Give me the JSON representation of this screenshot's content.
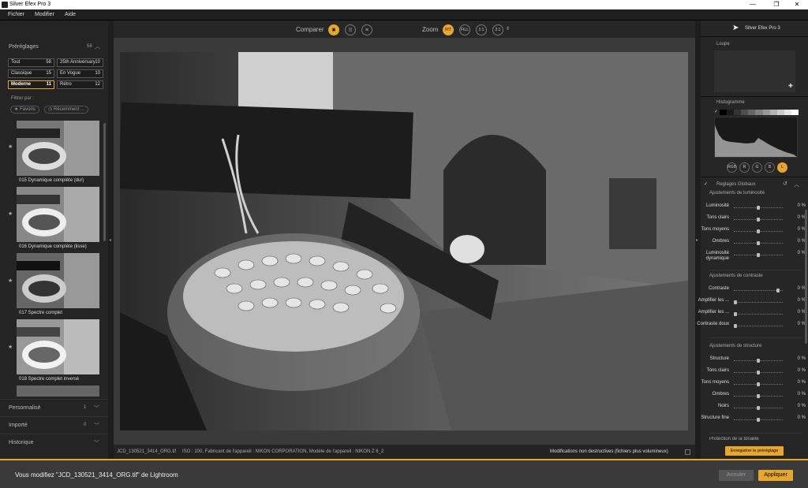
{
  "window": {
    "title": "Silver Efex Pro 3",
    "min": "—",
    "max": "❐",
    "close": "✕"
  },
  "menu": [
    "Fichier",
    "Modifier",
    "Aide"
  ],
  "left": {
    "presets_title": "Préréglages",
    "presets_count": "58",
    "presets": [
      {
        "label": "Tout",
        "count": "58"
      },
      {
        "label": "25th Anniversary",
        "count": "10"
      },
      {
        "label": "Classique",
        "count": "15"
      },
      {
        "label": "En Vogue",
        "count": "10"
      },
      {
        "label": "Moderne",
        "count": "11",
        "selected": true
      },
      {
        "label": "Rétro",
        "count": "12"
      }
    ],
    "filter_label": "Filtrer par :",
    "filter_favorites": "Favoris",
    "filter_recent": "Récemment ...",
    "items": [
      {
        "label": "015 Dynamique complète (dur)"
      },
      {
        "label": "016 Dynamique complète (lisse)"
      },
      {
        "label": "017 Spectre complet"
      },
      {
        "label": "018 Spectre complet inversé"
      }
    ],
    "custom": {
      "title": "Personnalisé",
      "count": "1"
    },
    "imported": {
      "title": "Importé",
      "count": "0"
    },
    "history": {
      "title": "Historique"
    }
  },
  "toolbar": {
    "compare_label": "Comparer",
    "zoom_label": "Zoom",
    "zoom_options": [
      "FIT",
      "FILL",
      "1:1",
      "2:1"
    ]
  },
  "status": {
    "filename": "JCD_130521_3414_ORG.tif",
    "meta": "ISO : 100, Fabricant de l'appareil : NIKON CORPORATION, Modèle de l'appareil : NIKON Z 6_2",
    "nondestructive": "Modifications non destructives (fichiers plus volumineux)"
  },
  "right": {
    "brand": "Silver Efex Pro 3",
    "loupe": "Loupe",
    "histogram": "Histogramme",
    "channels": [
      "RGB",
      "R",
      "G",
      "B",
      "L"
    ],
    "global_title": "Reglages Globaux",
    "lum_group": "Ajustements de luminosité",
    "lum": [
      {
        "label": "Luminosité",
        "value": "0 %",
        "pos": 0.5
      },
      {
        "label": "Tons clairs",
        "value": "0 %",
        "pos": 0.5
      },
      {
        "label": "Tons moyens",
        "value": "0 %",
        "pos": 0.5
      },
      {
        "label": "Ombres",
        "value": "0 %",
        "pos": 0.5
      },
      {
        "label": "Luminosité dynamique",
        "value": "0 %",
        "pos": 0.5
      }
    ],
    "contrast_group": "Ajustements de contraste",
    "contrast": [
      {
        "label": "Contraste",
        "value": "0 %",
        "pos": 0.93
      },
      {
        "label": "Amplifier les ...",
        "value": "0 %",
        "pos": 0.0
      },
      {
        "label": "Amplifier les ...",
        "value": "0 %",
        "pos": 0.0
      },
      {
        "label": "Contraste doux",
        "value": "0 %",
        "pos": 0.0
      }
    ],
    "structure_group": "Ajustements de structure",
    "structure": [
      {
        "label": "Structure",
        "value": "0 %",
        "pos": 0.5
      },
      {
        "label": "Tons clairs",
        "value": "0 %",
        "pos": 0.5
      },
      {
        "label": "Tons moyens",
        "value": "0 %",
        "pos": 0.5
      },
      {
        "label": "Ombres",
        "value": "0 %",
        "pos": 0.5
      },
      {
        "label": "Noirs",
        "value": "0 %",
        "pos": 0.5
      },
      {
        "label": "Structure fine",
        "value": "0 %",
        "pos": 0.5
      }
    ],
    "tone_protect": "Protection de la tonalité",
    "save_preset": "Enregistrer le préréglage"
  },
  "bottom": {
    "message": "Vous modifiez \"JCD_130521_3414_ORG.tif\" de Lightroom",
    "cancel": "Annuler",
    "apply": "Appliquer"
  },
  "colors": {
    "accent": "#e8a72a"
  }
}
